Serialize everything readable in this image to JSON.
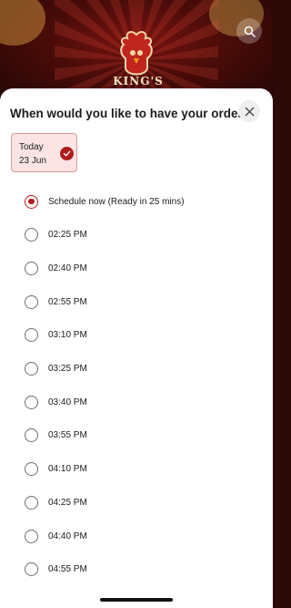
{
  "header": {
    "brand_text": "KING'S"
  },
  "sheet": {
    "title": "When would you like to have your order",
    "date_chip": {
      "day": "Today",
      "date": "23 Jun",
      "selected": true
    },
    "slots": [
      {
        "label": "Schedule now (Ready in 25 mins)",
        "selected": true
      },
      {
        "label": "02:25 PM",
        "selected": false
      },
      {
        "label": "02:40 PM",
        "selected": false
      },
      {
        "label": "02:55 PM",
        "selected": false
      },
      {
        "label": "03:10 PM",
        "selected": false
      },
      {
        "label": "03:25 PM",
        "selected": false
      },
      {
        "label": "03:40 PM",
        "selected": false
      },
      {
        "label": "03:55 PM",
        "selected": false
      },
      {
        "label": "04:10 PM",
        "selected": false
      },
      {
        "label": "04:25 PM",
        "selected": false
      },
      {
        "label": "04:40 PM",
        "selected": false
      },
      {
        "label": "04:55 PM",
        "selected": false
      }
    ]
  },
  "colors": {
    "accent": "#b01c1c",
    "chip_bg": "#fbe4e3",
    "chip_border": "#d99a9a"
  },
  "icons": {
    "search": "search-icon",
    "close": "close-icon",
    "check": "check-icon"
  }
}
